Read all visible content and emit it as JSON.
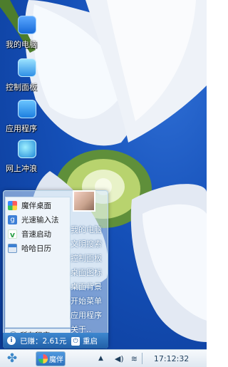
{
  "desktop": {
    "icons": [
      {
        "label": "我的电脑",
        "icon": "computer-icon"
      },
      {
        "label": "控制面板",
        "icon": "control-panel-icon"
      },
      {
        "label": "应用程序",
        "icon": "apps-icon"
      },
      {
        "label": "网上冲浪",
        "icon": "globe-icon"
      }
    ]
  },
  "start_menu": {
    "apps": [
      {
        "label": "魔伴桌面",
        "icon": "mofan-icon"
      },
      {
        "label": "光速输入法",
        "icon": "input-method-icon"
      },
      {
        "label": "音速启动",
        "icon": "voice-launch-icon"
      },
      {
        "label": "哈哈日历",
        "icon": "calendar-icon"
      }
    ],
    "all_programs": "所有程序",
    "links": [
      "我的电脑",
      "文明搜索",
      "控制面板",
      "桌面图标",
      "桌面背景",
      "开始菜单",
      "应用程序",
      "关于.."
    ],
    "earned": "已赚：2.61元",
    "restart": "重启"
  },
  "taskbar": {
    "task_label": "魔伴",
    "clock": "17:12:32"
  },
  "colors": {
    "accent": "#215fa7",
    "desktop_blue": "#1550b8"
  }
}
